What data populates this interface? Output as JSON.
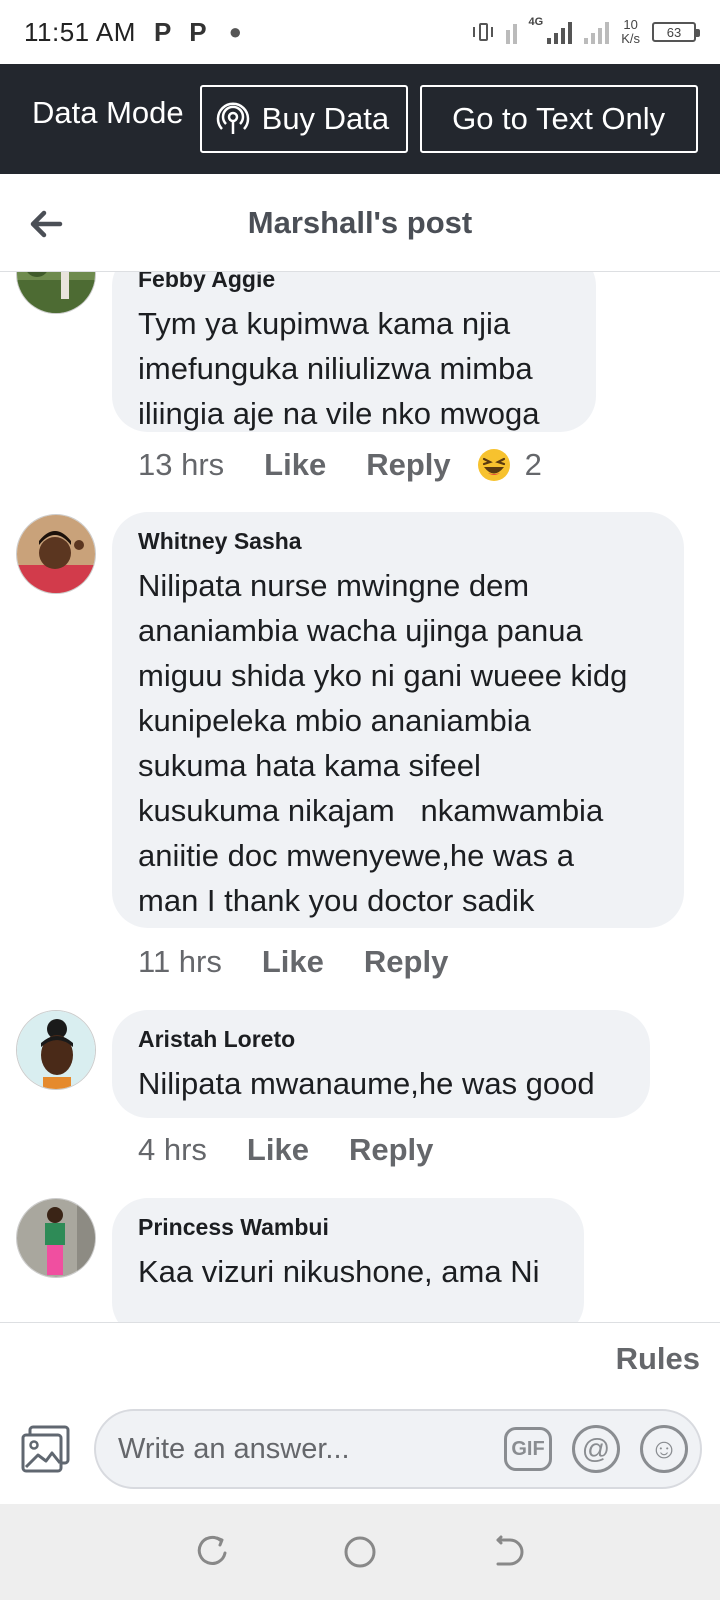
{
  "status_bar": {
    "time": "11:51 AM",
    "notif_icons": [
      "P",
      "P"
    ],
    "network_type": "4G",
    "speed_value": "10",
    "speed_unit": "K/s",
    "battery": "63"
  },
  "data_banner": {
    "label": "Data Mode",
    "buy_label": "Buy Data",
    "text_only_label": "Go to Text Only"
  },
  "header": {
    "title": "Marshall's post"
  },
  "comments": [
    {
      "author": "Febby Aggie",
      "text": "Tym ya kupimwa kama njia\nimefunguka niliulizwa mimba\niliingia aje na vile nko mwoga",
      "time": "13 hrs",
      "like": "Like",
      "reply": "Reply",
      "reaction_count": "2"
    },
    {
      "author": "Whitney Sasha",
      "text": "Nilipata nurse mwingne dem\nananiambia wacha ujinga panua\nmiguu shida yko ni gani wueee kidg\nkunipeleka mbio ananiambia\nsukuma hata kama sifeel\nkusukuma nikajam   nkamwambia\naniitie doc mwenyewe,he was a\nman I thank you doctor sadik",
      "time": "11 hrs",
      "like": "Like",
      "reply": "Reply"
    },
    {
      "author": "Aristah Loreto",
      "text": "Nilipata mwanaume,he was good",
      "time": "4 hrs",
      "like": "Like",
      "reply": "Reply"
    },
    {
      "author": "Princess Wambui",
      "text": "Kaa vizuri nikushone, ama Ni"
    }
  ],
  "bottom": {
    "rules_label": "Rules",
    "composer_placeholder": "Write an answer...",
    "gif_label": "GIF",
    "mention_symbol": "@",
    "emoji_symbol": "☺"
  },
  "colors": {
    "banner_bg": "#23272e",
    "bubble_bg": "#f0f2f5",
    "secondary_text": "#65676b",
    "nav_bg": "#eeeeee"
  }
}
